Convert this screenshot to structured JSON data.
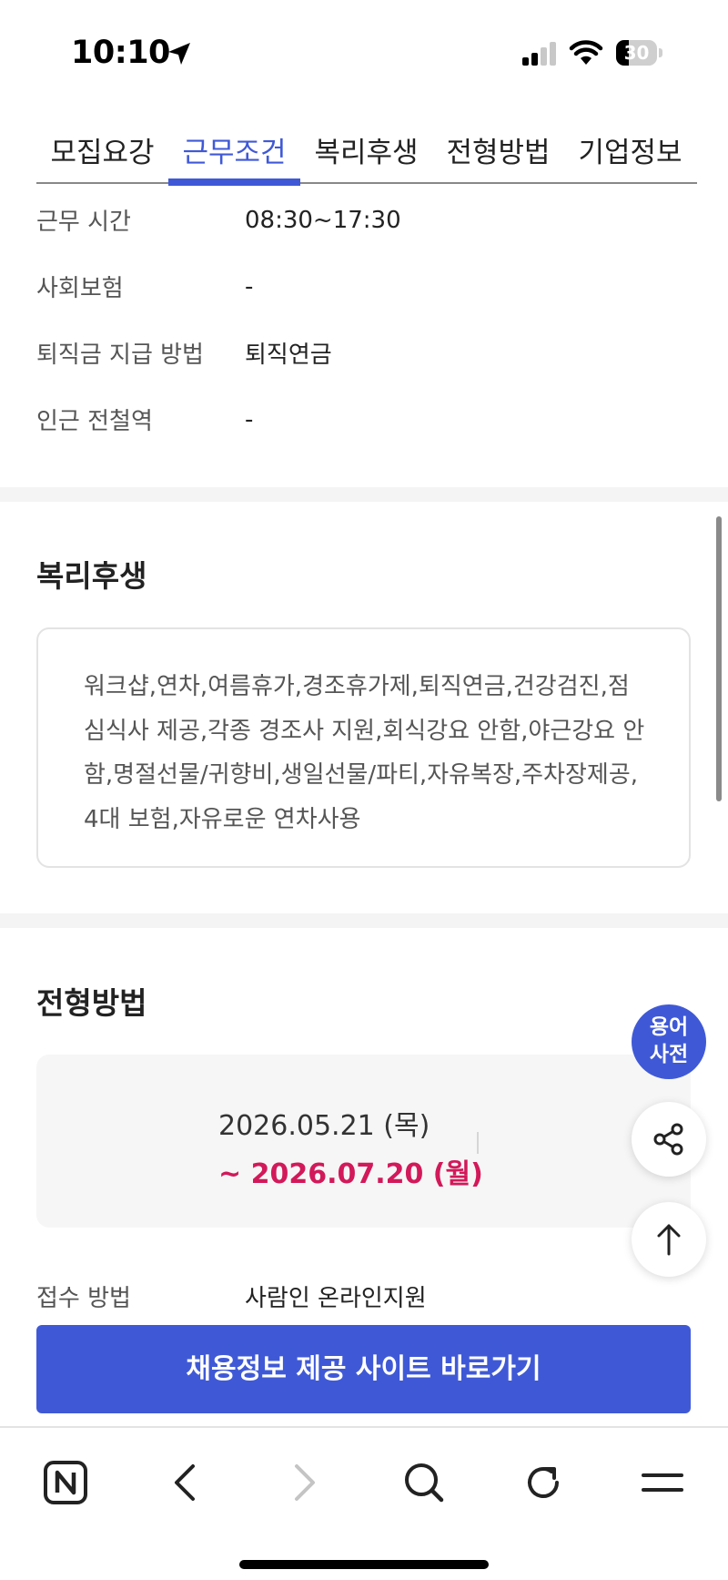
{
  "status_bar": {
    "time": "10:10",
    "battery_level": "30"
  },
  "tabs": [
    {
      "label": "모집요강",
      "active": false
    },
    {
      "label": "근무조건",
      "active": true
    },
    {
      "label": "복리후생",
      "active": false
    },
    {
      "label": "전형방법",
      "active": false
    },
    {
      "label": "기업정보",
      "active": false
    }
  ],
  "work_conditions": [
    {
      "label": "근무 시간",
      "value": "08:30~17:30"
    },
    {
      "label": "사회보험",
      "value": "-"
    },
    {
      "label": "퇴직금 지급 방법",
      "value": "퇴직연금"
    },
    {
      "label": "인근 전철역",
      "value": "-"
    }
  ],
  "benefits": {
    "title": "복리후생",
    "text": "워크샵,연차,여름휴가,경조휴가제,퇴직연금,건강검진,점심식사 제공,각종 경조사 지원,회식강요 안함,야근강요 안함,명절선물/귀향비,생일선물/파티,자유복장,주차장제공,4대 보험,자유로운 연차사용"
  },
  "selection": {
    "title": "전형방법",
    "period_start": "2026.05.21 (목)",
    "period_end": "~ 2026.07.20 (월)",
    "apply_label": "접수 방법",
    "apply_value": "사람인 온라인지원"
  },
  "cta": {
    "label": "채용정보 제공 사이트 바로가기"
  },
  "floating": {
    "dict_line1": "용어",
    "dict_line2": "사전"
  },
  "colors": {
    "accent": "#3f59d6",
    "deadline": "#d2195a"
  }
}
